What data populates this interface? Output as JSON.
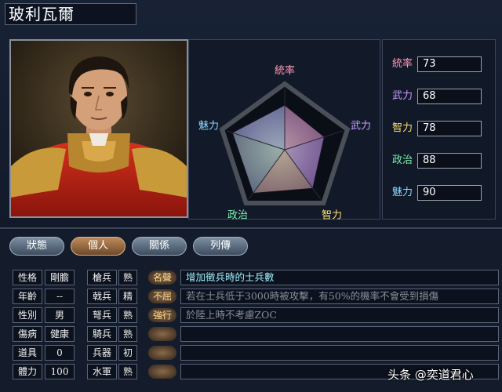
{
  "officer": {
    "name": "玻利瓦爾"
  },
  "portrait": {
    "alt": "officer-portrait"
  },
  "radar": {
    "axes": [
      "統率",
      "武力",
      "智力",
      "政治",
      "魅力"
    ],
    "values": [
      73,
      68,
      78,
      88,
      90
    ],
    "max": 100
  },
  "stats": [
    {
      "label": "統率",
      "value": "73",
      "color": "#ff9ab8"
    },
    {
      "label": "武力",
      "value": "68",
      "color": "#c89cff"
    },
    {
      "label": "智力",
      "value": "78",
      "color": "#ffe070"
    },
    {
      "label": "政治",
      "value": "88",
      "color": "#7ef0b0"
    },
    {
      "label": "魅力",
      "value": "90",
      "color": "#8ad8ff"
    }
  ],
  "tabs": [
    {
      "label": "狀態",
      "active": false
    },
    {
      "label": "個人",
      "active": true
    },
    {
      "label": "關係",
      "active": false
    },
    {
      "label": "列傳",
      "active": false
    }
  ],
  "personal": [
    {
      "label": "性格",
      "value": "剛膽"
    },
    {
      "label": "年齡",
      "value": "--"
    },
    {
      "label": "性別",
      "value": "男"
    },
    {
      "label": "傷病",
      "value": "健康"
    },
    {
      "label": "道具",
      "value": "0"
    },
    {
      "label": "體力",
      "value": "100"
    }
  ],
  "aptitudes": [
    {
      "label": "槍兵",
      "value": "熟"
    },
    {
      "label": "戟兵",
      "value": "精"
    },
    {
      "label": "弩兵",
      "value": "熟"
    },
    {
      "label": "騎兵",
      "value": "熟"
    },
    {
      "label": "兵器",
      "value": "初"
    },
    {
      "label": "水軍",
      "value": "熟"
    }
  ],
  "skills": [
    {
      "tag": "名聲",
      "desc": "增加徵兵時的士兵數",
      "desc_color": "#9ff0ff"
    },
    {
      "tag": "不屈",
      "desc": "若在士兵低于3000時被攻擊，有50%的機率不會受到損傷",
      "desc_color": "#8a8f9a"
    },
    {
      "tag": "強行",
      "desc": "於陸上時不考慮ZOC",
      "desc_color": "#8a8f9a"
    },
    {
      "tag": "",
      "desc": ""
    },
    {
      "tag": "",
      "desc": ""
    },
    {
      "tag": "",
      "desc": ""
    }
  ],
  "watermark": "头条 @奕道君心"
}
